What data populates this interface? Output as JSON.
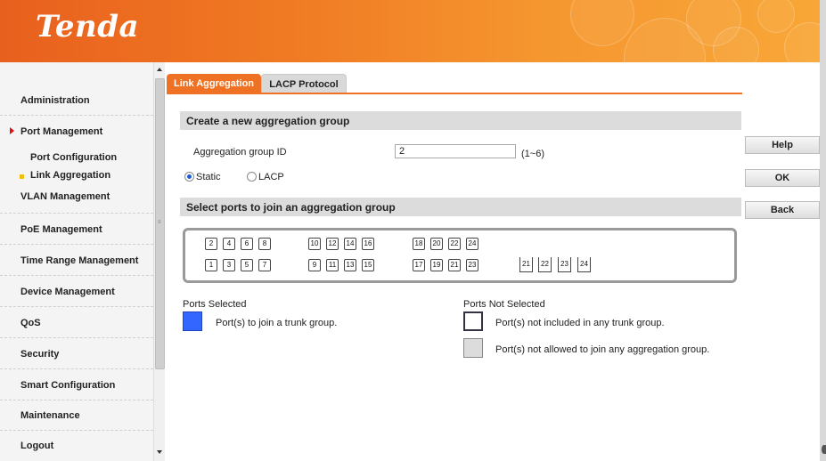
{
  "header": {
    "logo": "Tenda"
  },
  "sidebar": {
    "items": [
      {
        "label": "Administration"
      },
      {
        "label": "Port Management",
        "expanded": true,
        "children": [
          {
            "label": "Port Configuration"
          },
          {
            "label": "Link Aggregation",
            "active": true
          }
        ]
      },
      {
        "label": "VLAN Management"
      },
      {
        "label": "PoE Management"
      },
      {
        "label": "Time Range Management"
      },
      {
        "label": "Device Management"
      },
      {
        "label": "QoS"
      },
      {
        "label": "Security"
      },
      {
        "label": "Smart Configuration"
      },
      {
        "label": "Maintenance"
      },
      {
        "label": "Logout"
      }
    ]
  },
  "tabs": [
    {
      "label": "Link Aggregation",
      "active": true
    },
    {
      "label": "LACP Protocol",
      "active": false
    }
  ],
  "create_section": {
    "title": "Create a new aggregation group",
    "group_id_label": "Aggregation group ID",
    "group_id_value": "2",
    "range": "(1~6)",
    "mode_options": [
      "Static",
      "LACP"
    ],
    "mode_selected": "Static"
  },
  "select_section": {
    "title": "Select ports to join an aggregation group"
  },
  "ports": {
    "top_row": [
      "2",
      "4",
      "6",
      "8",
      "10",
      "12",
      "14",
      "16",
      "18",
      "20",
      "22",
      "24"
    ],
    "bottom_row": [
      "1",
      "3",
      "5",
      "7",
      "9",
      "11",
      "13",
      "15",
      "17",
      "19",
      "21",
      "23"
    ],
    "sfp": [
      "21",
      "22",
      "23",
      "24"
    ]
  },
  "buttons": {
    "help": "Help",
    "ok": "OK",
    "back": "Back"
  },
  "legend": {
    "selected_title": "Ports Selected",
    "selected_text": "Port(s) to join a trunk group.",
    "not_selected_title": "Ports Not Selected",
    "not_included_text": "Port(s) not included in any trunk group.",
    "not_allowed_text": "Port(s) not allowed to join any aggregation group."
  },
  "colors": {
    "accent": "#ef7224",
    "selected": "#3366ff",
    "not_allowed": "#dcdcdc"
  }
}
